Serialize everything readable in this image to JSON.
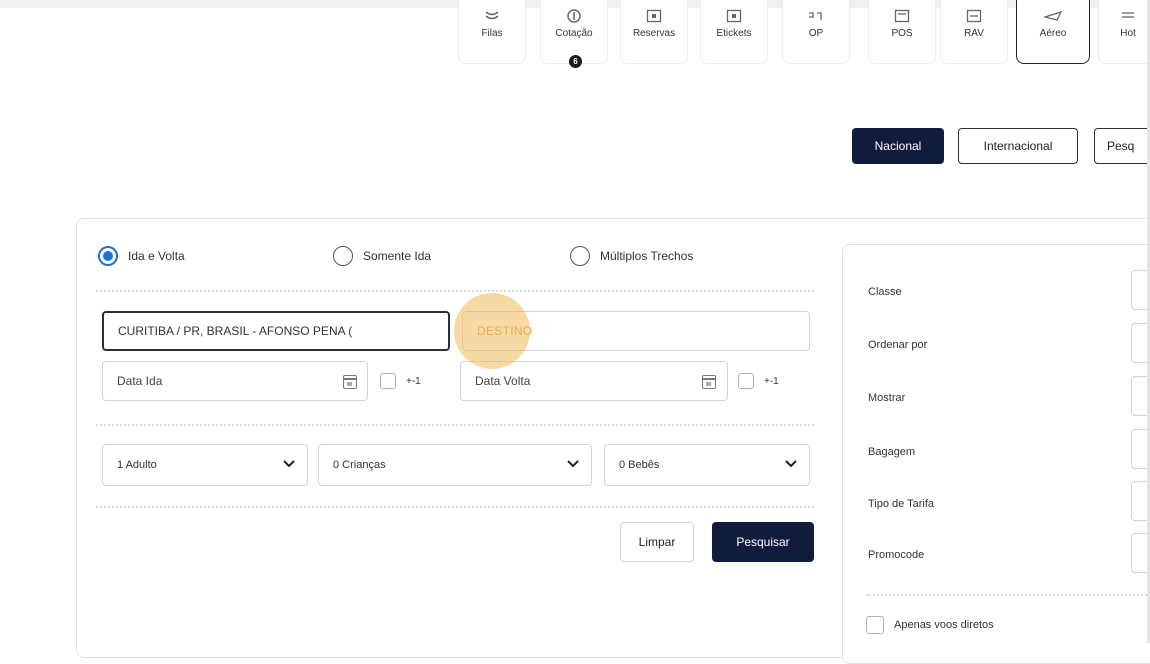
{
  "modules": [
    {
      "label": "Filas",
      "icon": "queue-icon"
    },
    {
      "label": "Cotação",
      "icon": "quote-icon",
      "badge": "6"
    },
    {
      "label": "Reservas",
      "icon": "reservations-icon"
    },
    {
      "label": "Etickets",
      "icon": "eticket-icon"
    },
    {
      "label": "OP",
      "icon": "op-icon"
    },
    {
      "label": "POS",
      "icon": "pos-icon"
    },
    {
      "label": "RAV",
      "icon": "rav-icon"
    },
    {
      "label": "Aéreo",
      "icon": "airplane-icon",
      "active": true
    },
    {
      "label": "Hot",
      "icon": "hotel-icon"
    }
  ],
  "type_tabs": {
    "nacional": "Nacional",
    "internacional": "Internacional",
    "pesquisa": "Pesq"
  },
  "trip_type": {
    "round_trip": "Ida e Volta",
    "one_way": "Somente Ida",
    "multi": "Múltiplos Trechos",
    "selected": "round_trip"
  },
  "search": {
    "origin_value": "CURITIBA / PR, BRASIL - AFONSO PENA (",
    "destination_placeholder": "DESTINO",
    "departure_placeholder": "Data Ida",
    "return_placeholder": "Data Volta",
    "flex_label": "+-1"
  },
  "passengers": {
    "adults": "1 Adulto",
    "children": "0 Crianças",
    "infants": "0 Bebês"
  },
  "actions": {
    "clear": "Limpar",
    "search": "Pesquisar"
  },
  "filters": {
    "classe": "Classe",
    "ordenar": "Ordenar por",
    "mostrar": "Mostrar",
    "bagagem": "Bagagem",
    "tipo_tarifa": "Tipo de Tarifa",
    "promocode": "Promocode",
    "direct_only": "Apenas voos diretos"
  },
  "colors": {
    "primary": "#111b3d",
    "radio_active": "#1f6fd6",
    "cursor_highlight": "#f0ba5a"
  }
}
